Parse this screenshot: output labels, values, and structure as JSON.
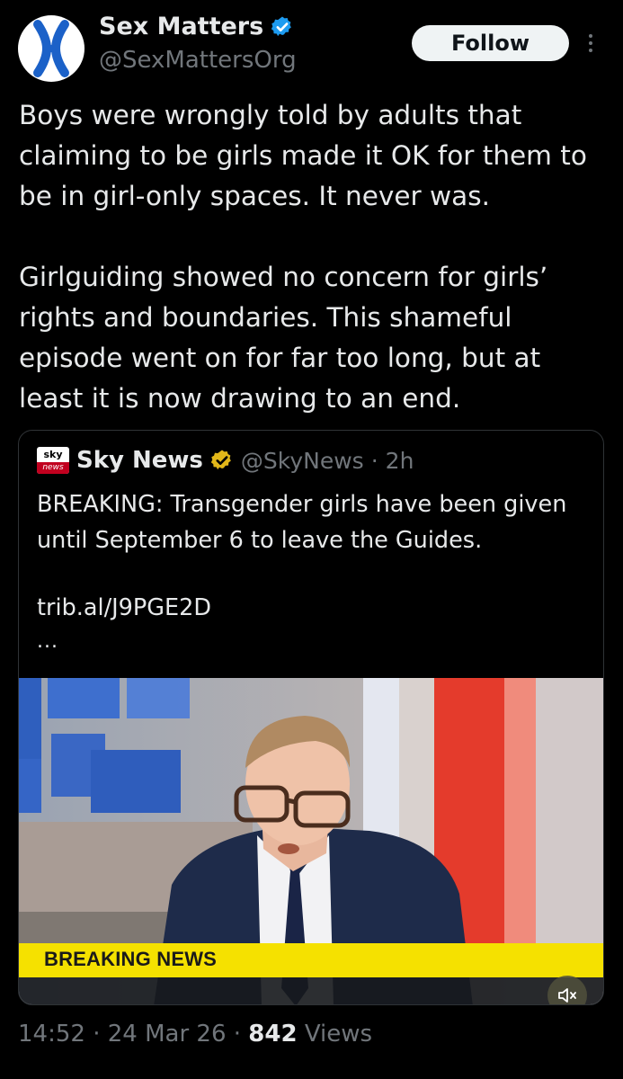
{
  "author": {
    "name": "Sex Matters",
    "handle": "@SexMattersOrg",
    "verified_color": "#1d9bf0",
    "avatar_icon": "x-chromosome-logo",
    "avatar_color": "#1b61c8"
  },
  "follow_label": "Follow",
  "more_icon": "vertical-ellipsis-icon",
  "tweet": {
    "paragraphs": [
      "Boys were wrongly told by adults that claiming to be girls made it OK for them to be in girl-only spaces. It never was.",
      "Girlguiding showed no concern for girls’ rights and boundaries. This shameful episode went on for far too long, but at least it is now drawing to an end."
    ]
  },
  "quote": {
    "logo_top": "sky",
    "logo_bottom": "news",
    "name": "Sky News",
    "verified_color": "#e2b719",
    "handle": "@SkyNews",
    "sep": "·",
    "time": "2h",
    "text": "BREAKING: Transgender girls have been given until September 6 to leave the Guides.",
    "link": "trib.al/J9PGE2D",
    "ellipsis": "...",
    "media": {
      "banner_text": "BREAKING NEWS",
      "mute_icon": "speaker-muted-icon",
      "banner_color": "#f5e100"
    }
  },
  "meta": {
    "time": "14:52",
    "sep1": " · ",
    "date": "24 Mar 26",
    "sep2": " · ",
    "views_count": "842",
    "views_label": " Views"
  }
}
